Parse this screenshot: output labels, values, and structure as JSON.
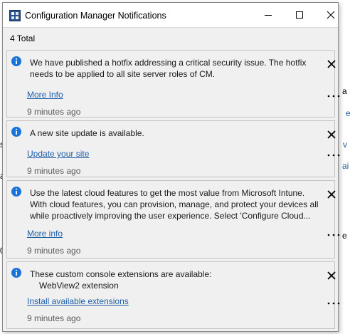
{
  "window": {
    "title": "Configuration Manager Notifications",
    "total_label": "4 Total"
  },
  "background": {
    "edge_texts": [
      "a",
      "e",
      "se",
      "a",
      "v",
      "ai",
      "e",
      "0"
    ]
  },
  "notifications": [
    {
      "message_lines": [
        "We have published a hotfix addressing a critical security issue. The hotfix",
        "needs to be applied to all site server roles of CM."
      ],
      "link": "More Info",
      "time": "9 minutes ago"
    },
    {
      "message_lines": [
        "A new site update is available."
      ],
      "link": "Update your site",
      "time": "9 minutes ago"
    },
    {
      "message_lines": [
        "Use the latest cloud features to get the most value from Microsoft Intune.",
        "With cloud features, you can provision, manage, and protect your devices all",
        "while proactively improving the user experience. Select 'Configure Cloud..."
      ],
      "link": "More info",
      "time": "9 minutes ago"
    },
    {
      "message_lines": [
        "These custom console extensions are available:"
      ],
      "sub_line": "WebView2 extension",
      "link": "Install available extensions",
      "time": "9 minutes ago"
    }
  ],
  "colors": {
    "info": "#1a73d9",
    "link": "#1f5fa8",
    "window_bg": "#f0f0f0"
  },
  "icons": {
    "app": "config-manager-icon",
    "info": "info-icon",
    "dismiss": "close-icon",
    "more": "more-options-icon"
  }
}
